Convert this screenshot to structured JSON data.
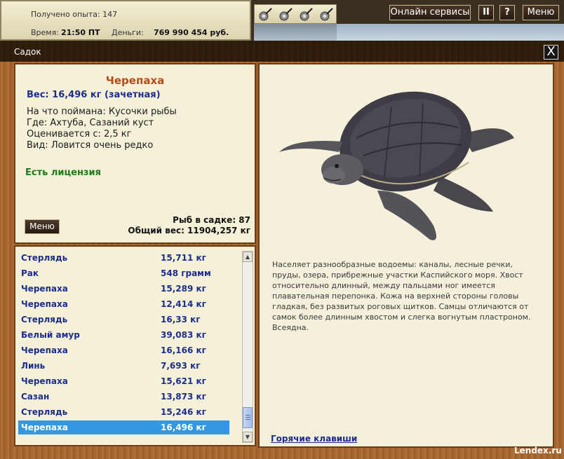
{
  "stats": {
    "exp_text": "Получено опыта: 147",
    "time_label": "Время:",
    "time_value": "21:50 ПТ",
    "money_label": "Деньги:",
    "money_value": "769 990 454 руб."
  },
  "toolbar": {
    "rods": [
      "fishing-rod-icon",
      "fishing-rod-icon",
      "fishing-rod-icon",
      "fishing-rod-icon"
    ],
    "online_label": "Онлайн сервисы",
    "pause_label": "II",
    "help_label": "?",
    "menu_label": "Меню"
  },
  "window": {
    "title": "Садок",
    "close_label": "X"
  },
  "fish_info": {
    "name": "Черепаха",
    "weight": "Вес: 16,496 кг (зачетная)",
    "bait": "На что поймана: Кусочки рыбы",
    "place": "Где: Ахтуба, Сазаний куст",
    "valued": "Оценивается с: 2,5 кг",
    "kind": "Вид: Ловится очень редко",
    "license": "Есть лицензия",
    "count": "Рыб в садке: 87",
    "total_weight": "Общий вес: 11904,257 кг",
    "menu_label": "Меню"
  },
  "catch_list": [
    {
      "name": "Стерлядь",
      "weight": "15,711 кг"
    },
    {
      "name": "Рак",
      "weight": "548 грамм"
    },
    {
      "name": "Черепаха",
      "weight": "15,289 кг"
    },
    {
      "name": "Черепаха",
      "weight": "12,414 кг"
    },
    {
      "name": "Стерлядь",
      "weight": "16,33 кг"
    },
    {
      "name": "Белый амур",
      "weight": "39,083 кг"
    },
    {
      "name": "Черепаха",
      "weight": "16,166 кг"
    },
    {
      "name": "Линь",
      "weight": "7,693 кг"
    },
    {
      "name": "Черепаха",
      "weight": "15,621 кг"
    },
    {
      "name": "Сазан",
      "weight": "13,873 кг"
    },
    {
      "name": "Стерлядь",
      "weight": "15,246 кг"
    },
    {
      "name": "Черепаха",
      "weight": "16,496 кг"
    }
  ],
  "description": {
    "text": "Населяет разнообразные водоемы: каналы, лесные речки, пруды, озера, прибрежные участки Каспийского моря. Хвост относительно длинный, между пальцами ног имеется плавательная перепонка. Кожа на верхней стороны головы гладкая, без развитых роговых щитков. Самцы отличаются от самок более длинным хвостом и слегка вогнутым пластроном. Всеядна.",
    "hotkeys_label": "Горячие клавиши"
  },
  "watermark": "Lendex.ru",
  "colors": {
    "fish_name": "#b84a16",
    "list_text": "#1d2d8c",
    "license": "#1e7a1c",
    "selected_row": "#3398e4"
  }
}
